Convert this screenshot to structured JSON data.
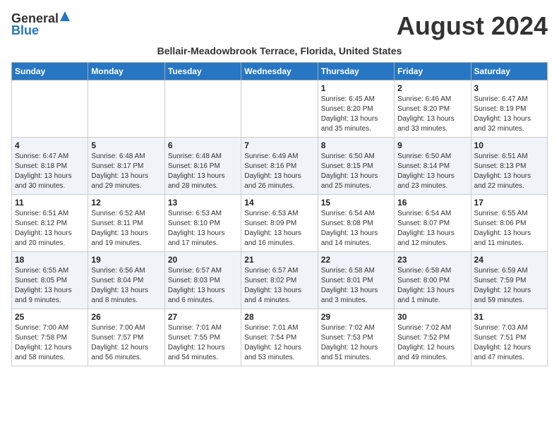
{
  "header": {
    "logo_general": "General",
    "logo_blue": "Blue",
    "month_title": "August 2024",
    "subtitle": "Bellair-Meadowbrook Terrace, Florida, United States"
  },
  "days_of_week": [
    "Sunday",
    "Monday",
    "Tuesday",
    "Wednesday",
    "Thursday",
    "Friday",
    "Saturday"
  ],
  "weeks": [
    [
      {
        "day": "",
        "sunrise": "",
        "sunset": "",
        "daylight": ""
      },
      {
        "day": "",
        "sunrise": "",
        "sunset": "",
        "daylight": ""
      },
      {
        "day": "",
        "sunrise": "",
        "sunset": "",
        "daylight": ""
      },
      {
        "day": "",
        "sunrise": "",
        "sunset": "",
        "daylight": ""
      },
      {
        "day": "1",
        "sunrise": "6:45 AM",
        "sunset": "8:20 PM",
        "daylight": "13 hours and 35 minutes."
      },
      {
        "day": "2",
        "sunrise": "6:46 AM",
        "sunset": "8:20 PM",
        "daylight": "13 hours and 33 minutes."
      },
      {
        "day": "3",
        "sunrise": "6:47 AM",
        "sunset": "8:19 PM",
        "daylight": "13 hours and 32 minutes."
      }
    ],
    [
      {
        "day": "4",
        "sunrise": "6:47 AM",
        "sunset": "8:18 PM",
        "daylight": "13 hours and 30 minutes."
      },
      {
        "day": "5",
        "sunrise": "6:48 AM",
        "sunset": "8:17 PM",
        "daylight": "13 hours and 29 minutes."
      },
      {
        "day": "6",
        "sunrise": "6:48 AM",
        "sunset": "8:16 PM",
        "daylight": "13 hours and 28 minutes."
      },
      {
        "day": "7",
        "sunrise": "6:49 AM",
        "sunset": "8:16 PM",
        "daylight": "13 hours and 26 minutes."
      },
      {
        "day": "8",
        "sunrise": "6:50 AM",
        "sunset": "8:15 PM",
        "daylight": "13 hours and 25 minutes."
      },
      {
        "day": "9",
        "sunrise": "6:50 AM",
        "sunset": "8:14 PM",
        "daylight": "13 hours and 23 minutes."
      },
      {
        "day": "10",
        "sunrise": "6:51 AM",
        "sunset": "8:13 PM",
        "daylight": "13 hours and 22 minutes."
      }
    ],
    [
      {
        "day": "11",
        "sunrise": "6:51 AM",
        "sunset": "8:12 PM",
        "daylight": "13 hours and 20 minutes."
      },
      {
        "day": "12",
        "sunrise": "6:52 AM",
        "sunset": "8:11 PM",
        "daylight": "13 hours and 19 minutes."
      },
      {
        "day": "13",
        "sunrise": "6:53 AM",
        "sunset": "8:10 PM",
        "daylight": "13 hours and 17 minutes."
      },
      {
        "day": "14",
        "sunrise": "6:53 AM",
        "sunset": "8:09 PM",
        "daylight": "13 hours and 16 minutes."
      },
      {
        "day": "15",
        "sunrise": "6:54 AM",
        "sunset": "8:08 PM",
        "daylight": "13 hours and 14 minutes."
      },
      {
        "day": "16",
        "sunrise": "6:54 AM",
        "sunset": "8:07 PM",
        "daylight": "13 hours and 12 minutes."
      },
      {
        "day": "17",
        "sunrise": "6:55 AM",
        "sunset": "8:06 PM",
        "daylight": "13 hours and 11 minutes."
      }
    ],
    [
      {
        "day": "18",
        "sunrise": "6:55 AM",
        "sunset": "8:05 PM",
        "daylight": "13 hours and 9 minutes."
      },
      {
        "day": "19",
        "sunrise": "6:56 AM",
        "sunset": "8:04 PM",
        "daylight": "13 hours and 8 minutes."
      },
      {
        "day": "20",
        "sunrise": "6:57 AM",
        "sunset": "8:03 PM",
        "daylight": "13 hours and 6 minutes."
      },
      {
        "day": "21",
        "sunrise": "6:57 AM",
        "sunset": "8:02 PM",
        "daylight": "13 hours and 4 minutes."
      },
      {
        "day": "22",
        "sunrise": "6:58 AM",
        "sunset": "8:01 PM",
        "daylight": "13 hours and 3 minutes."
      },
      {
        "day": "23",
        "sunrise": "6:58 AM",
        "sunset": "8:00 PM",
        "daylight": "13 hours and 1 minute."
      },
      {
        "day": "24",
        "sunrise": "6:59 AM",
        "sunset": "7:59 PM",
        "daylight": "12 hours and 59 minutes."
      }
    ],
    [
      {
        "day": "25",
        "sunrise": "7:00 AM",
        "sunset": "7:58 PM",
        "daylight": "12 hours and 58 minutes."
      },
      {
        "day": "26",
        "sunrise": "7:00 AM",
        "sunset": "7:57 PM",
        "daylight": "12 hours and 56 minutes."
      },
      {
        "day": "27",
        "sunrise": "7:01 AM",
        "sunset": "7:55 PM",
        "daylight": "12 hours and 54 minutes."
      },
      {
        "day": "28",
        "sunrise": "7:01 AM",
        "sunset": "7:54 PM",
        "daylight": "12 hours and 53 minutes."
      },
      {
        "day": "29",
        "sunrise": "7:02 AM",
        "sunset": "7:53 PM",
        "daylight": "12 hours and 51 minutes."
      },
      {
        "day": "30",
        "sunrise": "7:02 AM",
        "sunset": "7:52 PM",
        "daylight": "12 hours and 49 minutes."
      },
      {
        "day": "31",
        "sunrise": "7:03 AM",
        "sunset": "7:51 PM",
        "daylight": "12 hours and 47 minutes."
      }
    ]
  ]
}
